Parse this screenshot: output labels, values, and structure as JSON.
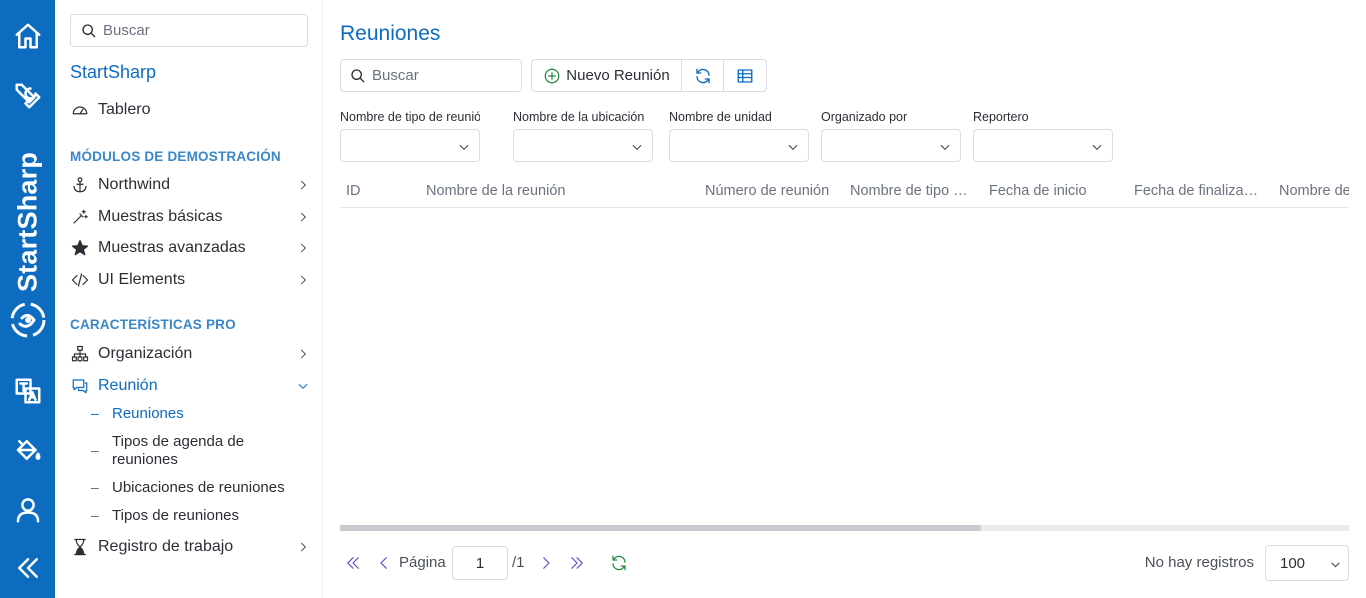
{
  "rail": {
    "brand_text": "StartSharp",
    "icons": [
      "home-icon",
      "tools-icon",
      "translate-icon",
      "paint-bucket-icon",
      "user-icon",
      "collapse-icon"
    ],
    "color": "#0d6cc0"
  },
  "sidebar": {
    "search_placeholder": "Buscar",
    "app_title": "StartSharp",
    "dashboard_label": "Tablero",
    "section_demo": "MÓDULOS DE DEMOSTRACIÓN",
    "demo_items": [
      {
        "label": "Northwind",
        "icon": "anchor-icon"
      },
      {
        "label": "Muestras básicas",
        "icon": "magic-wand-icon"
      },
      {
        "label": "Muestras avanzadas",
        "icon": "star-icon"
      },
      {
        "label": "UI Elements",
        "icon": "code-icon"
      }
    ],
    "section_pro": "CARACTERÍSTICAS PRO",
    "pro_items": [
      {
        "label": "Organización",
        "icon": "org-chart-icon"
      },
      {
        "label": "Reunión",
        "icon": "chat-icon"
      }
    ],
    "meeting_sub": [
      "Reuniones",
      "Tipos de agenda de reuniones",
      "Ubicaciones de reuniones",
      "Tipos de reuniones"
    ],
    "worklog_label": "Registro de trabajo"
  },
  "main": {
    "title": "Reuniones",
    "search_placeholder": "Buscar",
    "new_button": "Nuevo Reunión",
    "filters": [
      "Nombre de tipo de reunión",
      "Nombre de la ubicación",
      "Nombre de unidad",
      "Organizado por",
      "Reportero"
    ],
    "columns": [
      "ID",
      "Nombre de la reunión",
      "Número de reunión",
      "Nombre de tipo de reunión",
      "Fecha de inicio",
      "Fecha de finalización",
      "Nombre de"
    ]
  },
  "pager": {
    "page_label": "Página",
    "page_value": "1",
    "page_total": "/1",
    "no_records": "No hay registros",
    "page_size": "100"
  }
}
